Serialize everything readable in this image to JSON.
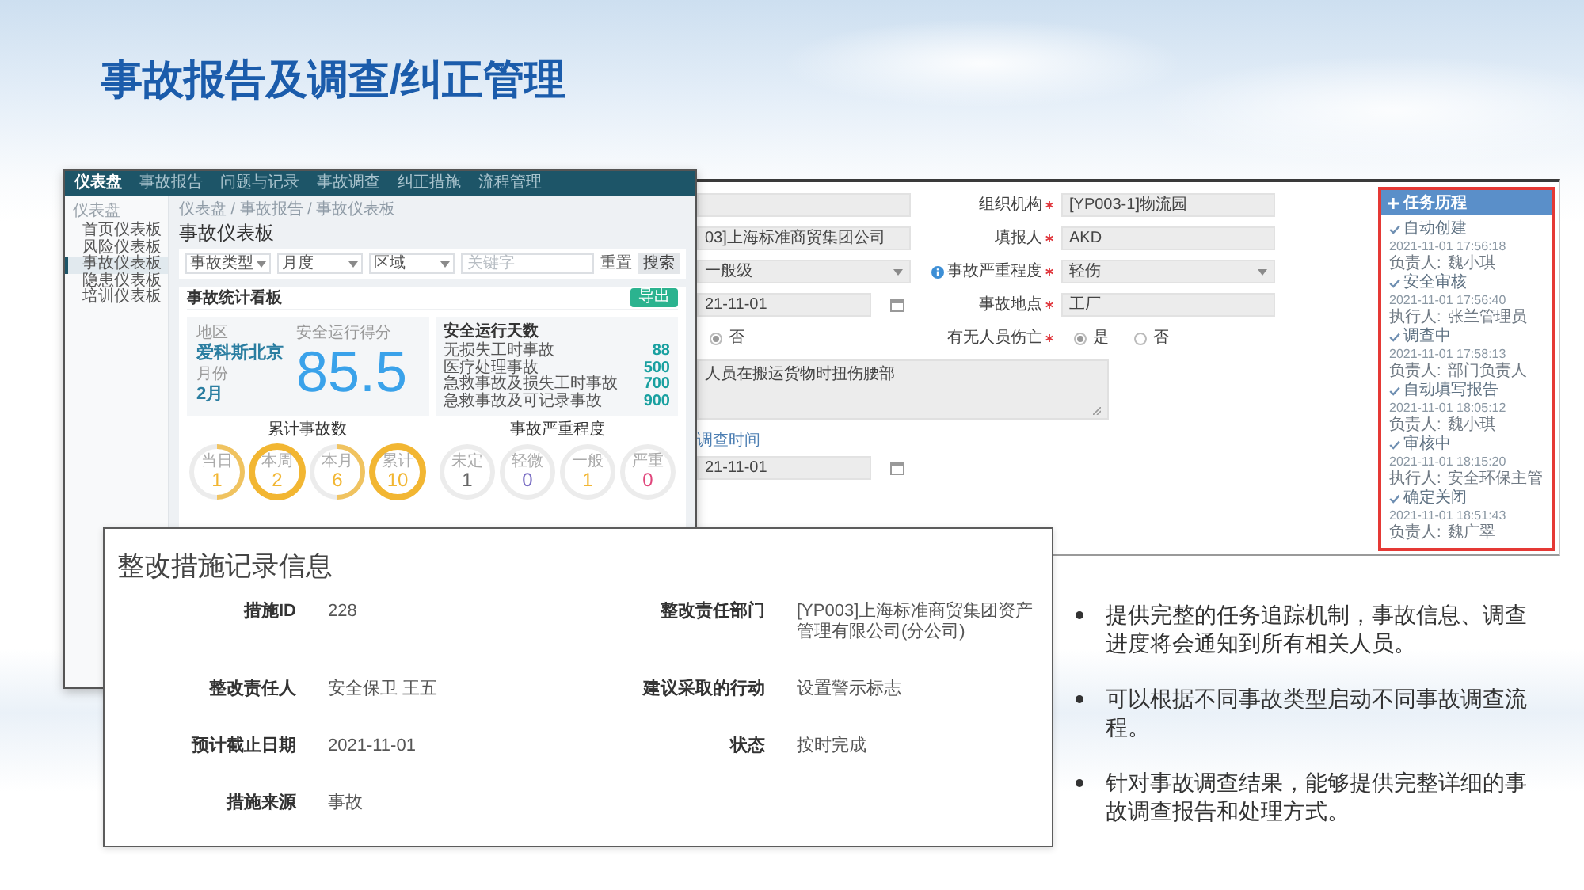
{
  "title": "事故报告及调查/纠正管理",
  "dashboard": {
    "nav": [
      {
        "label": "仪表盘",
        "selected": true
      },
      {
        "label": "事故报告",
        "selected": false
      },
      {
        "label": "问题与记录",
        "selected": false
      },
      {
        "label": "事故调查",
        "selected": false
      },
      {
        "label": "纠正措施",
        "selected": false
      },
      {
        "label": "流程管理",
        "selected": false
      }
    ],
    "sidebar": {
      "heading": "仪表盘",
      "items": [
        {
          "label": "首页仪表板",
          "selected": false
        },
        {
          "label": "风险仪表板",
          "selected": false
        },
        {
          "label": "事故仪表板",
          "selected": true
        },
        {
          "label": "隐患仪表板",
          "selected": false
        },
        {
          "label": "培训仪表板",
          "selected": false
        }
      ]
    },
    "breadcrumb": "仪表盘 / 事故报告 / 事故仪表板",
    "page_title": "事故仪表板",
    "filters": [
      {
        "kind": "select",
        "value": "事故类型"
      },
      {
        "kind": "select",
        "value": "月度"
      },
      {
        "kind": "select",
        "value": "区域"
      },
      {
        "kind": "input",
        "placeholder": "关键字"
      }
    ],
    "buttons": [
      {
        "kind": "text",
        "label": "重置"
      },
      {
        "kind": "filled",
        "label": "搜索"
      }
    ],
    "stats": {
      "title": "事故统计看板",
      "action": "导出",
      "region_label": "地区",
      "region": "爱科斯北京",
      "month_label": "月份",
      "month": "2月",
      "score_label": "安全运行得分",
      "score": "85.5",
      "days_title": "安全运行天数",
      "days": [
        {
          "label": "无损失工时事故",
          "value": "88"
        },
        {
          "label": "医疗处理事故",
          "value": "500"
        },
        {
          "label": "急救事故及损失工时事故",
          "value": "700"
        },
        {
          "label": "急救事故及可记录事故",
          "value": "900"
        }
      ]
    },
    "ring_groups": [
      {
        "title": "累计事故数",
        "rings": [
          {
            "kind": "arc",
            "label": "当日",
            "value": "1",
            "color": "#f2b632"
          },
          {
            "kind": "full",
            "label": "本周",
            "value": "2",
            "color": "#f2b632"
          },
          {
            "kind": "arc",
            "label": "本月",
            "value": "6",
            "color": "#f2b632"
          },
          {
            "kind": "full",
            "label": "累计",
            "value": "10",
            "color": "#f2b632"
          }
        ]
      },
      {
        "title": "事故严重程度",
        "rings": [
          {
            "kind": "plain",
            "label": "未定",
            "value": "1",
            "color": "#666666"
          },
          {
            "kind": "plain",
            "label": "轻微",
            "value": "0",
            "color": "#7b6fc4"
          },
          {
            "kind": "plain",
            "label": "一般",
            "value": "1",
            "color": "#f2b632"
          },
          {
            "kind": "plain",
            "label": "严重",
            "value": "0",
            "color": "#e0457b"
          }
        ]
      }
    ]
  },
  "form": {
    "rows": [
      {
        "left": {
          "kind": "input"
        },
        "right": {
          "label": "组织机构",
          "required": true,
          "kind": "input",
          "value": "[YP003-1]物流园"
        }
      },
      {
        "left": {
          "kind": "input",
          "value": "03]上海标准商贸集团公司"
        },
        "right": {
          "label": "填报人",
          "required": true,
          "kind": "input",
          "value": "AKD"
        }
      },
      {
        "left": {
          "kind": "select",
          "value": "一般级"
        },
        "right": {
          "label": "事故严重程度",
          "required": true,
          "info": true,
          "kind": "select",
          "value": "轻伤"
        }
      },
      {
        "left": {
          "kind": "date",
          "value": "21-11-01"
        },
        "right": {
          "label": "事故地点",
          "required": true,
          "kind": "input",
          "value": "工厂"
        }
      },
      {
        "left": {
          "kind": "radio",
          "options": [
            {
              "label": "否",
              "selected": true
            }
          ]
        },
        "right": {
          "label": "有无人员伤亡",
          "required": true,
          "kind": "radio",
          "options": [
            {
              "label": "是",
              "selected": true
            },
            {
              "label": "否",
              "selected": false
            }
          ]
        }
      }
    ],
    "description": "人员在搬运货物时扭伤腰部",
    "section_label": "调查时间",
    "date": "21-11-01"
  },
  "task_history": {
    "title": "任务历程",
    "steps": [
      {
        "status": "自动创建",
        "time": "2021-11-01 17:56:18",
        "role": "负责人:",
        "person": "魏小琪"
      },
      {
        "status": "安全审核",
        "time": "2021-11-01 17:56:40",
        "role": "执行人:",
        "person": "张兰管理员"
      },
      {
        "status": "调查中",
        "time": "2021-11-01 17:58:13",
        "role": "负责人:",
        "person": "部门负责人"
      },
      {
        "status": "自动填写报告",
        "time": "2021-11-01 18:05:12",
        "role": "负责人:",
        "person": "魏小琪"
      },
      {
        "status": "审核中",
        "time": "2021-11-01 18:15:20",
        "role": "执行人:",
        "person": "安全环保主管"
      },
      {
        "status": "确定关闭",
        "time": "2021-11-01 18:51:43",
        "role": "负责人:",
        "person": "魏广翠"
      }
    ]
  },
  "record": {
    "title": "整改措施记录信息",
    "fields": [
      {
        "label": "措施ID",
        "value": "228"
      },
      {
        "label": "整改责任部门",
        "value": "[YP003]上海标准商贸集团资产管理有限公司(分公司)"
      },
      {
        "label": "整改责任人",
        "value": "安全保卫 王五"
      },
      {
        "label": "建议采取的行动",
        "value": "设置警示标志"
      },
      {
        "label": "预计截止日期",
        "value": "2021-11-01"
      },
      {
        "label": "状态",
        "value": "按时完成"
      },
      {
        "label": "措施来源",
        "value": "事故"
      }
    ]
  },
  "bullets": [
    "提供完整的任务追踪机制，事故信息、调查进度将会通知到所有相关人员。",
    "可以根据不同事故类型启动不同事故调查流程。",
    "针对事故调查结果，能够提供完整详细的事故调查报告和处理方式。"
  ]
}
